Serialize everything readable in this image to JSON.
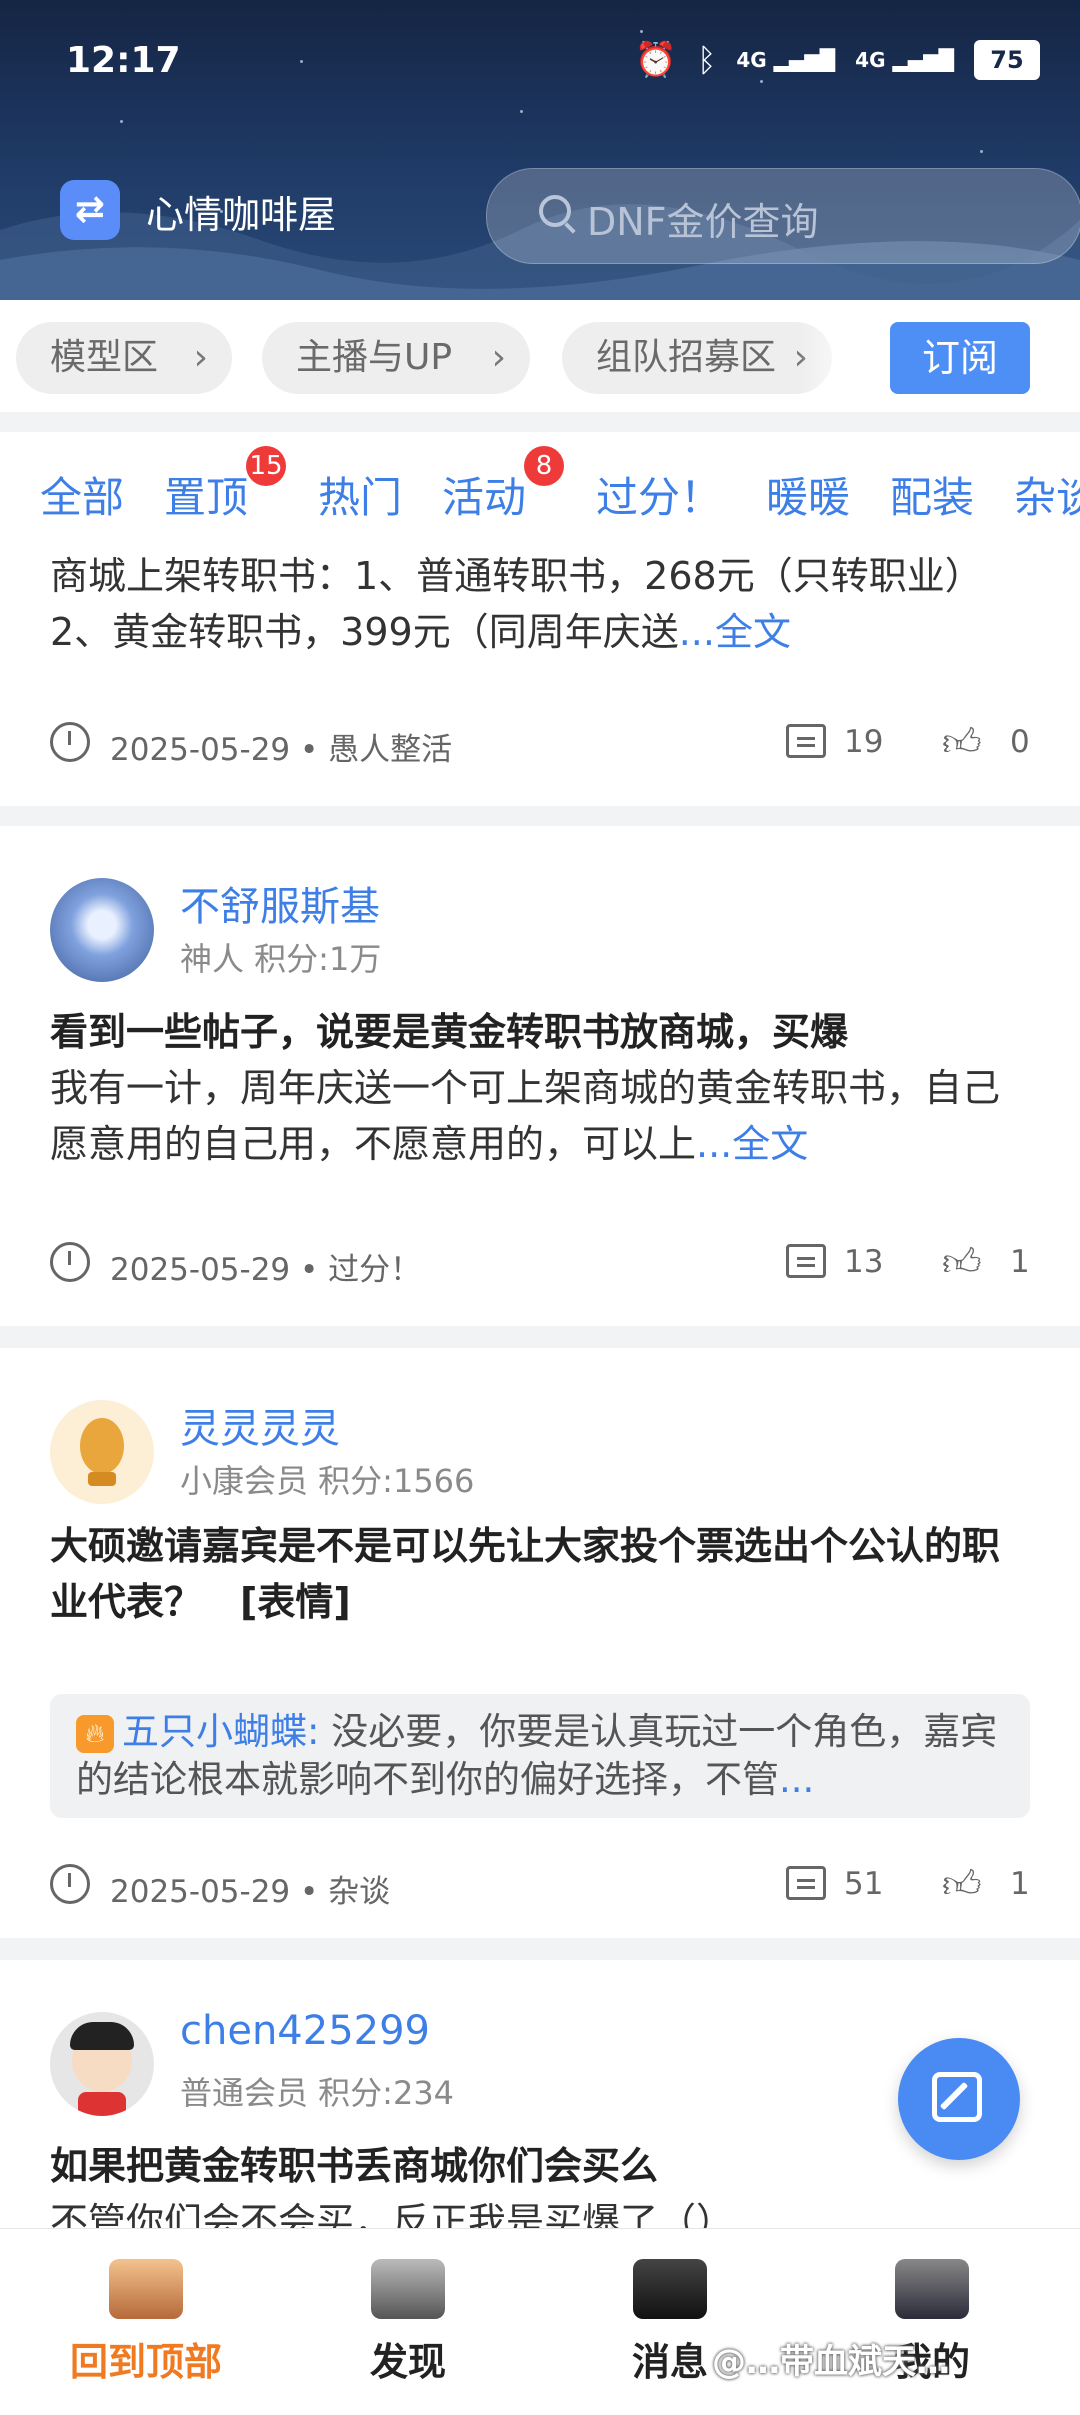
{
  "status_bar": {
    "time": "12:17",
    "battery": "75",
    "signal1": "4G",
    "signal2": "4G"
  },
  "app": {
    "title": "心情咖啡屋",
    "search_placeholder": "DNF金价查询"
  },
  "categories": [
    {
      "label": "模型区"
    },
    {
      "label": "主播与UP"
    },
    {
      "label": "组队招募区"
    }
  ],
  "subscribe_label": "订阅",
  "tabs": [
    {
      "label": "全部"
    },
    {
      "label": "置顶",
      "badge": "15"
    },
    {
      "label": "热门"
    },
    {
      "label": "活动",
      "badge": "8"
    },
    {
      "label": "过分！"
    },
    {
      "label": "暖暖"
    },
    {
      "label": "配装"
    },
    {
      "label": "杂谈"
    }
  ],
  "posts": [
    {
      "body": "商城上架转职书：1、普通转职书，268元（只转职业）2、黄金转职书，399元（同周年庆送",
      "more": "...全文",
      "date": "2025-05-29 • 愚人整活",
      "comments": "19",
      "likes": "0"
    },
    {
      "author": "不舒服斯基",
      "meta": "神人  积分:1万",
      "title": "看到一些帖子，说要是黄金转职书放商城，买爆",
      "body": "我有一计，周年庆送一个可上架商城的黄金转职书，自己愿意用的自己用，不愿意用的，可以上",
      "more": "...全文",
      "date": "2025-05-29 • 过分！",
      "comments": "13",
      "likes": "1"
    },
    {
      "author": "灵灵灵灵",
      "meta": "小康会员  积分:1566",
      "title": "大硕邀请嘉宾是不是可以先让大家投个票选出个公认的职业代表？　[表情]",
      "quote_name": "五只小蝴蝶:",
      "quote_text": " 没必要，你要是认真玩过一个角色，嘉宾的结论根本就影响不到你的偏好选择，不管",
      "quote_more": "...",
      "date": "2025-05-29 • 杂谈",
      "comments": "51",
      "likes": "1"
    },
    {
      "author": "chen425299",
      "meta": "普通会员  积分:234",
      "title": "如果把黄金转职书丢商城你们会买么",
      "body": "不管你们会不会买，反正我是买爆了（）"
    }
  ],
  "bottom_nav": [
    {
      "label": "回到顶部"
    },
    {
      "label": "发现"
    },
    {
      "label": "消息"
    },
    {
      "label": "我的"
    }
  ],
  "watermark": "@…带血斌天…",
  "colors": {
    "accent": "#3e7fe7",
    "active_nav": "#f07a22",
    "badge": "#ef3a3a"
  }
}
